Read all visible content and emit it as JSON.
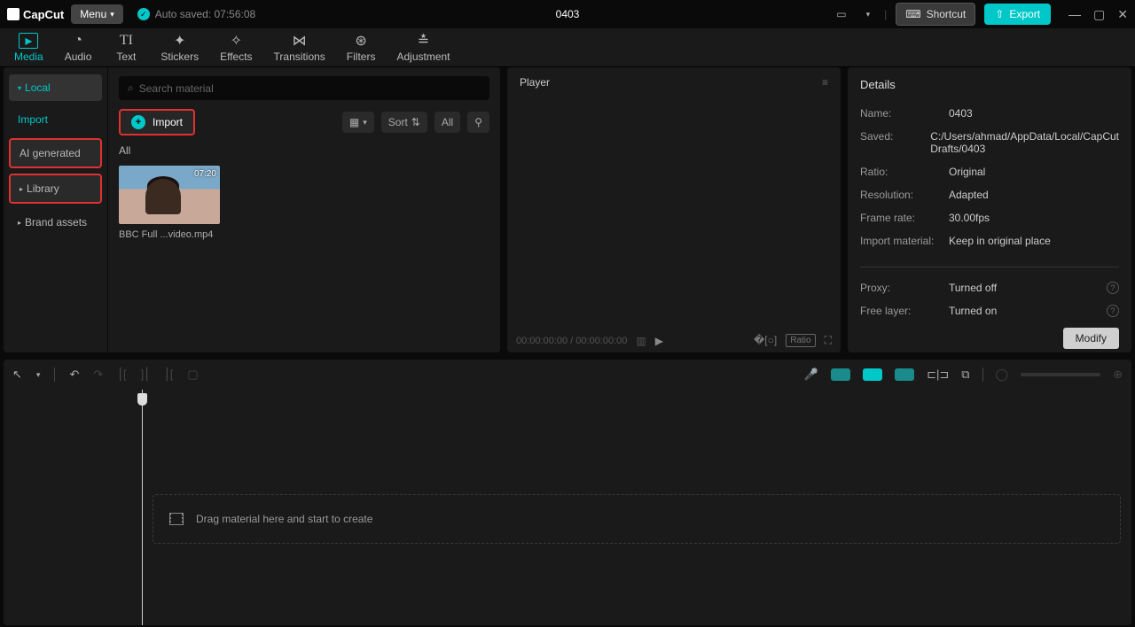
{
  "app": {
    "name": "CapCut"
  },
  "titlebar": {
    "menu": "Menu",
    "autosave": "Auto saved: 07:56:08",
    "project": "0403",
    "shortcut": "Shortcut",
    "export": "Export"
  },
  "toptabs": {
    "media": "Media",
    "audio": "Audio",
    "text": "Text",
    "stickers": "Stickers",
    "effects": "Effects",
    "transitions": "Transitions",
    "filters": "Filters",
    "adjustment": "Adjustment"
  },
  "sidebar": {
    "local": "Local",
    "import": "Import",
    "ai_generated": "AI generated",
    "library": "Library",
    "brand_assets": "Brand assets"
  },
  "media": {
    "search_placeholder": "Search material",
    "import_btn": "Import",
    "sort": "Sort",
    "all": "All",
    "section": "All",
    "thumb_duration": "07:20",
    "thumb_name": "BBC Full ...video.mp4"
  },
  "player": {
    "title": "Player",
    "time": "00:00:00:00 / 00:00:00:00",
    "ratio": "Ratio"
  },
  "details": {
    "title": "Details",
    "name_label": "Name:",
    "name_value": "0403",
    "saved_label": "Saved:",
    "saved_value": "C:/Users/ahmad/AppData/Local/CapCut Drafts/0403",
    "ratio_label": "Ratio:",
    "ratio_value": "Original",
    "resolution_label": "Resolution:",
    "resolution_value": "Adapted",
    "framerate_label": "Frame rate:",
    "framerate_value": "30.00fps",
    "importmat_label": "Import material:",
    "importmat_value": "Keep in original place",
    "proxy_label": "Proxy:",
    "proxy_value": "Turned off",
    "freelayer_label": "Free layer:",
    "freelayer_value": "Turned on",
    "modify": "Modify"
  },
  "timeline": {
    "drop_hint": "Drag material here and start to create"
  }
}
